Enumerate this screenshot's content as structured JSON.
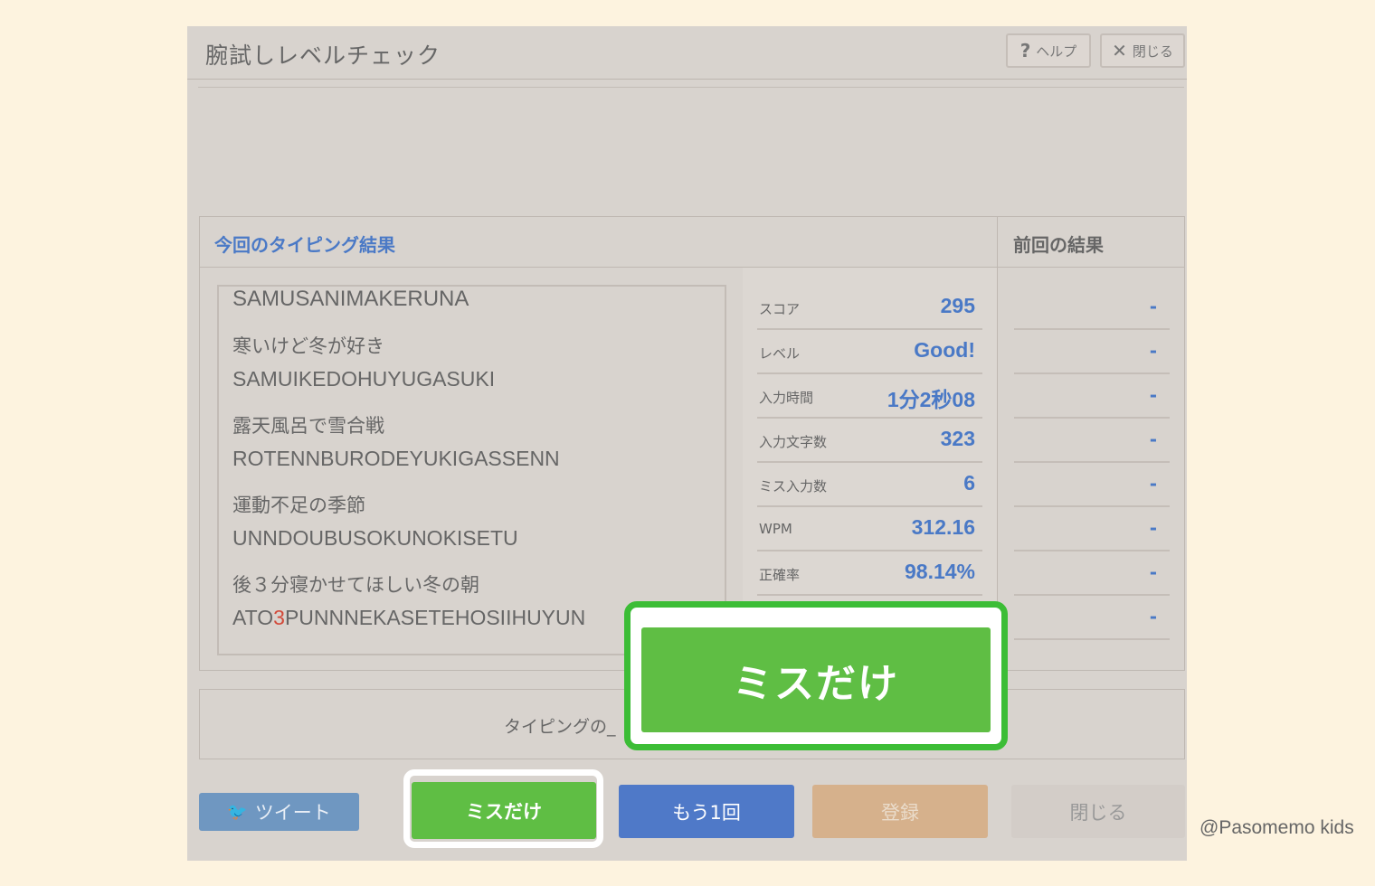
{
  "window": {
    "title": "腕試しレベルチェック",
    "help_icon": "?",
    "help_label": "ヘルプ",
    "close_icon": "✕",
    "close_label": "閉じる"
  },
  "results": {
    "current_title": "今回のタイピング結果",
    "previous_title": "前回の結果",
    "log_first": "SAMUSANIMAKERUNA",
    "log": [
      {
        "ja": "寒いけど冬が好き",
        "romaji": "SAMUIKEDOHUYUGASUKI"
      },
      {
        "ja": "露天風呂で雪合戦",
        "romaji": "ROTENNBURODEYUKIGASSENN"
      },
      {
        "ja": "運動不足の季節",
        "romaji": "UNNDOUBUSOKUNOKISETU"
      },
      {
        "ja": "後３分寝かせてほしい冬の朝",
        "romaji_pre": "ATO",
        "romaji_miss": "3",
        "romaji_post": "PUNNNEKASETEHOSIIHUYUN"
      }
    ],
    "stats": [
      {
        "label": "スコア",
        "value": "295",
        "previous": "-"
      },
      {
        "label": "レベル",
        "value": "Good!",
        "previous": "-"
      },
      {
        "label": "入力時間",
        "value": "1分2秒08",
        "previous": "-"
      },
      {
        "label": "入力文字数",
        "value": "323",
        "previous": "-"
      },
      {
        "label": "ミス入力数",
        "value": "6",
        "previous": "-"
      },
      {
        "label": "WPM",
        "value": "312.16",
        "previous": "-"
      },
      {
        "label": "正確率",
        "value": "98.14%",
        "previous": "-"
      }
    ],
    "extra_previous": "-"
  },
  "share": {
    "text": "タイピングの_"
  },
  "footer": {
    "tweet_icon": "twitter-bird",
    "tweet_label": "ツイート",
    "miss_only_label": "ミスだけ",
    "again_label": "もう1回",
    "register_label": "登録",
    "close_label": "閉じる"
  },
  "callout": {
    "label": "ミスだけ",
    "ring_color": "#3cbd36"
  },
  "credit": "@Pasomemo kids",
  "colors": {
    "accent_blue": "#4a79c6",
    "green": "#5fbe44",
    "miss_red": "#d24a3a"
  }
}
